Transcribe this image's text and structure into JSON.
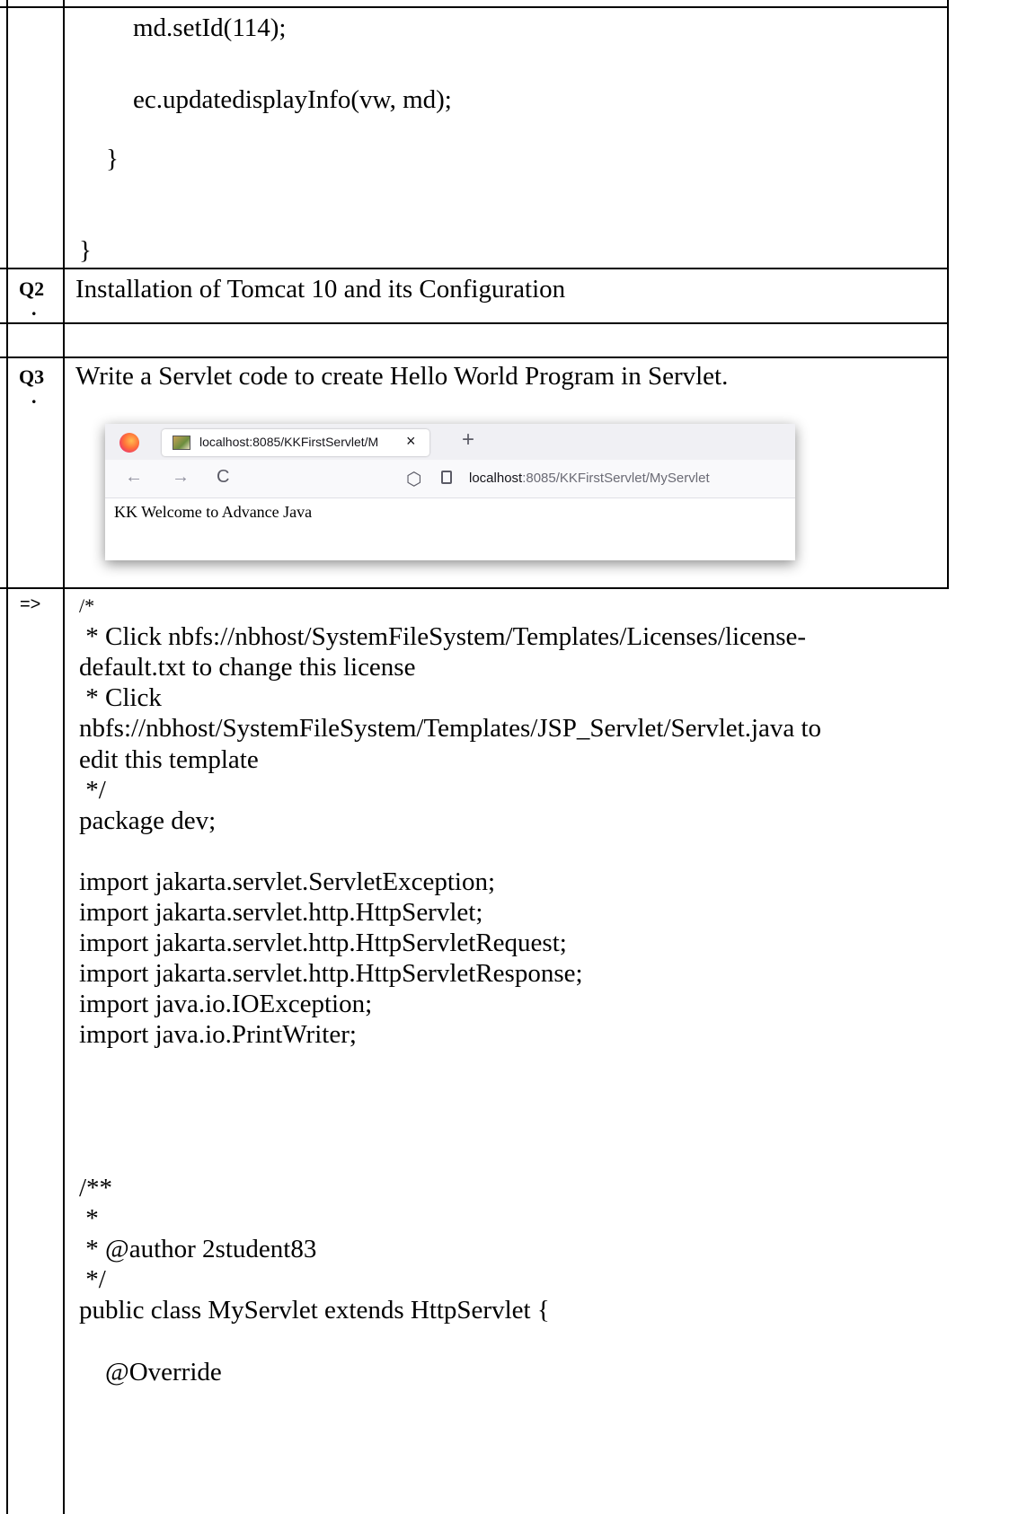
{
  "top_code": [
    "md.setId(114);",
    "ec.updatedisplayInfo(vw, md);",
    "}",
    "}"
  ],
  "rows": {
    "q2": {
      "label": "Q2",
      "dot": ".",
      "text": "Installation of Tomcat 10 and its Configuration"
    },
    "q3": {
      "label": "Q3",
      "dot": ".",
      "text": "Write a Servlet code to create Hello World Program in Servlet."
    },
    "answer_marker": "=>"
  },
  "browser": {
    "tab_title": "localhost:8085/KKFirstServlet/M",
    "tab_close": "×",
    "new_tab": "+",
    "back": "←",
    "forward": "→",
    "reload": "C",
    "url_host": "localhost",
    "url_rest": ":8085/KKFirstServlet/MyServlet",
    "page_text": "KK Welcome to Advance Java"
  },
  "code_lines": [
    "/*",
    " * Click nbfs://nbhost/SystemFileSystem/Templates/Licenses/license-",
    "default.txt to change this license",
    " * Click",
    "nbfs://nbhost/SystemFileSystem/Templates/JSP_Servlet/Servlet.java to",
    "edit this template",
    " */",
    "package dev;",
    "",
    "import jakarta.servlet.ServletException;",
    "import jakarta.servlet.http.HttpServlet;",
    "import jakarta.servlet.http.HttpServletRequest;",
    "import jakarta.servlet.http.HttpServletResponse;",
    "import java.io.IOException;",
    "import java.io.PrintWriter;",
    "",
    "",
    "",
    "",
    "/**",
    " *",
    " * @author 2student83",
    " */",
    "public class MyServlet extends HttpServlet {",
    "",
    "    @Override"
  ]
}
